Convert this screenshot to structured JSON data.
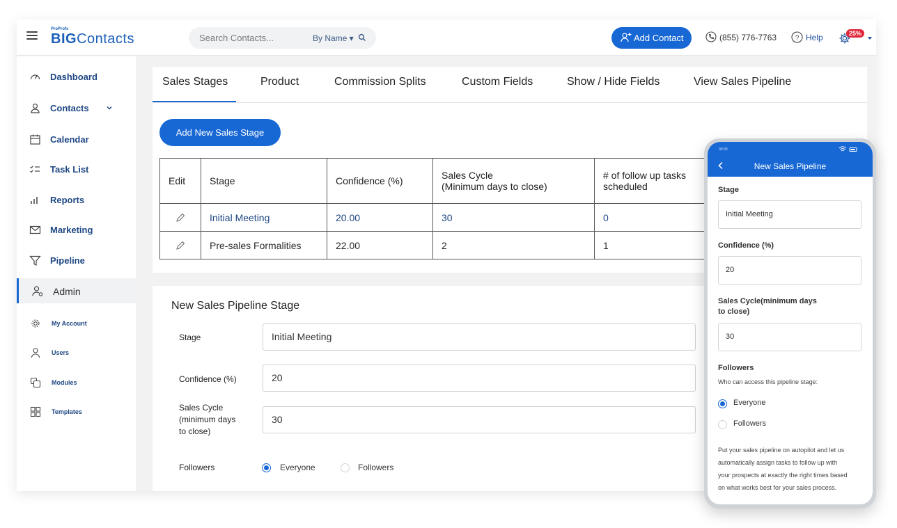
{
  "header": {
    "logo_small": "ProProfs",
    "logo_big": "BIG",
    "logo_rest": "Contacts",
    "search_placeholder": "Search Contacts...",
    "search_by": "By Name ▾",
    "add_contact_label": "Add Contact",
    "phone_number": "(855) 776-7763",
    "help_label": "Help",
    "notification_badge": "25%"
  },
  "sidebar": {
    "items": [
      {
        "label": "Dashboard",
        "icon": "dashboard-icon"
      },
      {
        "label": "Contacts",
        "icon": "contacts-icon"
      },
      {
        "label": "Calendar",
        "icon": "calendar-icon"
      },
      {
        "label": "Task List",
        "icon": "task-list-icon"
      },
      {
        "label": "Reports",
        "icon": "reports-icon"
      },
      {
        "label": "Marketing",
        "icon": "marketing-icon"
      },
      {
        "label": "Pipeline",
        "icon": "pipeline-icon"
      },
      {
        "label": "Admin",
        "icon": "admin-icon"
      }
    ],
    "sub_items": [
      {
        "label": "My Account",
        "icon": "gear-icon"
      },
      {
        "label": "Users",
        "icon": "user-icon"
      },
      {
        "label": "Modules",
        "icon": "modules-icon"
      },
      {
        "label": "Templates",
        "icon": "templates-icon"
      }
    ],
    "active": "Admin"
  },
  "tabs": [
    "Sales Stages",
    "Product",
    "Commission Splits",
    "Custom Fields",
    "Show / Hide Fields",
    "View Sales Pipeline"
  ],
  "active_tab": "Sales Stages",
  "add_stage_label": "Add New Sales Stage",
  "table": {
    "headers": [
      "Edit",
      "Stage",
      "Confidence (%)",
      "Sales Cycle\n(Minimum days to close)",
      "# of follow up tasks\nscheduled"
    ],
    "h_sales_cycle_1": "Sales Cycle",
    "h_sales_cycle_2": "(Minimum days to close)",
    "h_followup_1": "# of follow up tasks",
    "h_followup_2": "scheduled",
    "rows": [
      {
        "stage": "Initial Meeting",
        "confidence": "20.00",
        "cycle": "30",
        "tasks": "0"
      },
      {
        "stage": "Pre-sales Formalities",
        "confidence": "22.00",
        "cycle": "2",
        "tasks": "1"
      }
    ]
  },
  "form": {
    "title": "New Sales Pipeline Stage",
    "stage_label": "Stage",
    "stage_value": "Initial Meeting",
    "confidence_label": "Confidence (%)",
    "confidence_value": "20",
    "cycle_label_1": "Sales Cycle",
    "cycle_label_2": "(minimum days",
    "cycle_label_3": "to close)",
    "cycle_value": "30",
    "followers_label": "Followers",
    "opt_everyone": "Everyone",
    "opt_followers": "Followers",
    "selected": "Everyone"
  },
  "mobile": {
    "status_time": "00:00",
    "title": "New Sales Pipeline",
    "stage_label": "Stage",
    "stage_value": "Initial Meeting",
    "confidence_label": "Confidence (%)",
    "confidence_value": "20",
    "cycle_label_1": "Sales Cycle(minimum days",
    "cycle_label_2": "to close)",
    "cycle_value": "30",
    "followers_label": "Followers",
    "followers_sub": "Who can access this pipeline stage:",
    "opt_everyone": "Everyone",
    "opt_followers": "Followers",
    "promo_1": "Put your sales pipeline on autopilot and let us",
    "promo_2": "automatically assign tasks to follow up with",
    "promo_3": "your prospects at exactly the right times based",
    "promo_4": "on what works best for your sales process."
  },
  "colors": {
    "accent": "#1768d4",
    "nav_text": "#1e4783",
    "badge": "#e0263a"
  }
}
